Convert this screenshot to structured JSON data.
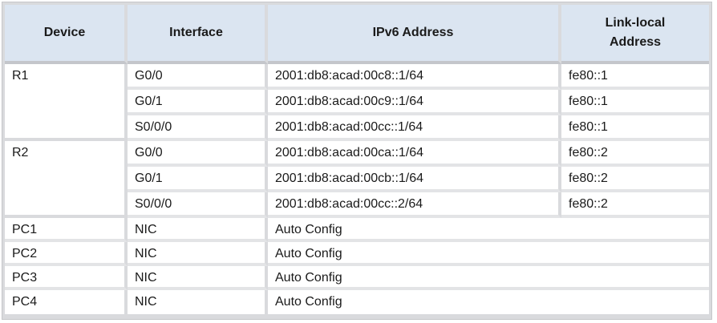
{
  "headers": [
    "Device",
    "Interface",
    "IPv6 Address",
    "Link-local Address"
  ],
  "groups": [
    {
      "device": "R1",
      "rows": [
        {
          "interface": "G0/0",
          "ipv6": "2001:db8:acad:00c8::1/64",
          "link_local": "fe80::1"
        },
        {
          "interface": "G0/1",
          "ipv6": "2001:db8:acad:00c9::1/64",
          "link_local": "fe80::1"
        },
        {
          "interface": "S0/0/0",
          "ipv6": "2001:db8:acad:00cc::1/64",
          "link_local": "fe80::1"
        }
      ]
    },
    {
      "device": "R2",
      "rows": [
        {
          "interface": "G0/0",
          "ipv6": "2001:db8:acad:00ca::1/64",
          "link_local": "fe80::2"
        },
        {
          "interface": "G0/1",
          "ipv6": "2001:db8:acad:00cb::1/64",
          "link_local": "fe80::2"
        },
        {
          "interface": "S0/0/0",
          "ipv6": "2001:db8:acad:00cc::2/64",
          "link_local": "fe80::2"
        }
      ]
    }
  ],
  "pcs": [
    {
      "device": "PC1",
      "interface": "NIC",
      "address": "Auto Config"
    },
    {
      "device": "PC2",
      "interface": "NIC",
      "address": "Auto Config"
    },
    {
      "device": "PC3",
      "interface": "NIC",
      "address": "Auto Config"
    },
    {
      "device": "PC4",
      "interface": "NIC",
      "address": "Auto Config"
    }
  ]
}
